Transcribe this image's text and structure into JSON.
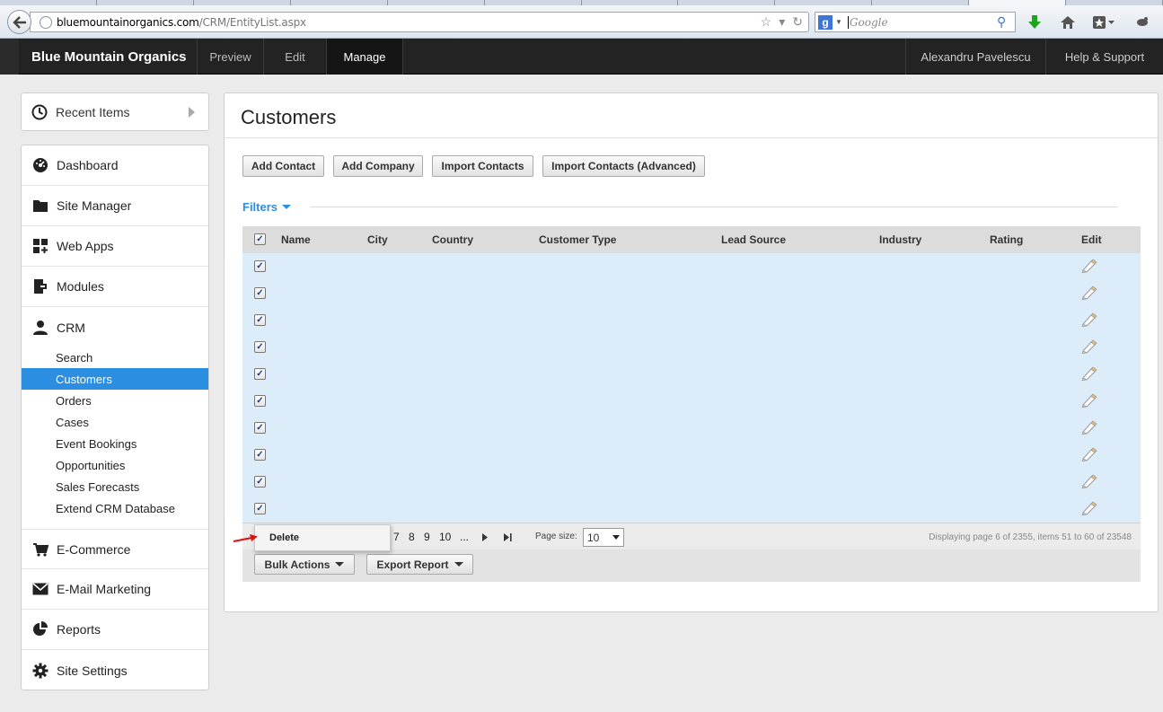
{
  "browser": {
    "url_host": "bluemountainorganics.com",
    "url_path": "/CRM/EntityList.aspx",
    "search_placeholder": "Google"
  },
  "app": {
    "brand": "Blue Mountain Organics",
    "nav": [
      {
        "label": "Preview",
        "active": false
      },
      {
        "label": "Edit",
        "active": false
      },
      {
        "label": "Manage",
        "active": true
      }
    ],
    "user": "Alexandru Pavelescu",
    "help": "Help & Support"
  },
  "sidebar": {
    "recent": "Recent Items",
    "items": [
      {
        "label": "Dashboard",
        "icon": "dashboard-icon"
      },
      {
        "label": "Site Manager",
        "icon": "folder-icon"
      },
      {
        "label": "Web Apps",
        "icon": "web-apps-icon"
      },
      {
        "label": "Modules",
        "icon": "modules-icon"
      },
      {
        "label": "CRM",
        "icon": "user-icon"
      },
      {
        "label": "E-Commerce",
        "icon": "cart-icon"
      },
      {
        "label": "E-Mail Marketing",
        "icon": "envelope-icon"
      },
      {
        "label": "Reports",
        "icon": "pie-chart-icon"
      },
      {
        "label": "Site Settings",
        "icon": "gear-icon"
      }
    ],
    "crm_sub": [
      {
        "label": "Search",
        "active": false
      },
      {
        "label": "Customers",
        "active": true
      },
      {
        "label": "Orders",
        "active": false
      },
      {
        "label": "Cases",
        "active": false
      },
      {
        "label": "Event Bookings",
        "active": false
      },
      {
        "label": "Opportunities",
        "active": false
      },
      {
        "label": "Sales Forecasts",
        "active": false
      },
      {
        "label": "Extend CRM Database",
        "active": false
      }
    ]
  },
  "main": {
    "title": "Customers",
    "buttons": [
      "Add Contact",
      "Add Company",
      "Import Contacts",
      "Import Contacts (Advanced)"
    ],
    "filters": "Filters",
    "columns": [
      "Name",
      "City",
      "Country",
      "Customer Type",
      "Lead Source",
      "Industry",
      "Rating",
      "Edit"
    ],
    "row_count": 10,
    "pager": {
      "pages": [
        "7",
        "8",
        "9",
        "10",
        "..."
      ],
      "page_size_label": "Page size:",
      "page_size": "10",
      "info": "Displaying page 6 of 2355, items 51 to 60 of 23548"
    },
    "actions": [
      "Bulk Actions",
      "Export Report"
    ],
    "popup_item": "Delete"
  }
}
